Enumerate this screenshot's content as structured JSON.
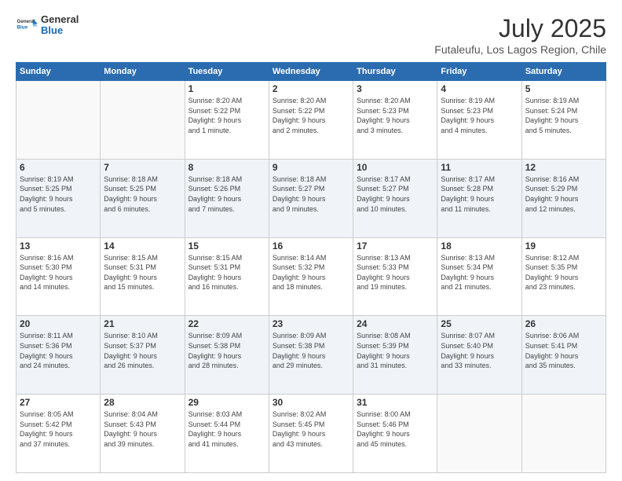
{
  "header": {
    "logo_general": "General",
    "logo_blue": "Blue",
    "main_title": "July 2025",
    "subtitle": "Futaleufu, Los Lagos Region, Chile"
  },
  "weekdays": [
    "Sunday",
    "Monday",
    "Tuesday",
    "Wednesday",
    "Thursday",
    "Friday",
    "Saturday"
  ],
  "weeks": [
    [
      {
        "day": "",
        "info": ""
      },
      {
        "day": "",
        "info": ""
      },
      {
        "day": "1",
        "info": "Sunrise: 8:20 AM\nSunset: 5:22 PM\nDaylight: 9 hours\nand 1 minute."
      },
      {
        "day": "2",
        "info": "Sunrise: 8:20 AM\nSunset: 5:22 PM\nDaylight: 9 hours\nand 2 minutes."
      },
      {
        "day": "3",
        "info": "Sunrise: 8:20 AM\nSunset: 5:23 PM\nDaylight: 9 hours\nand 3 minutes."
      },
      {
        "day": "4",
        "info": "Sunrise: 8:19 AM\nSunset: 5:23 PM\nDaylight: 9 hours\nand 4 minutes."
      },
      {
        "day": "5",
        "info": "Sunrise: 8:19 AM\nSunset: 5:24 PM\nDaylight: 9 hours\nand 5 minutes."
      }
    ],
    [
      {
        "day": "6",
        "info": "Sunrise: 8:19 AM\nSunset: 5:25 PM\nDaylight: 9 hours\nand 5 minutes."
      },
      {
        "day": "7",
        "info": "Sunrise: 8:18 AM\nSunset: 5:25 PM\nDaylight: 9 hours\nand 6 minutes."
      },
      {
        "day": "8",
        "info": "Sunrise: 8:18 AM\nSunset: 5:26 PM\nDaylight: 9 hours\nand 7 minutes."
      },
      {
        "day": "9",
        "info": "Sunrise: 8:18 AM\nSunset: 5:27 PM\nDaylight: 9 hours\nand 9 minutes."
      },
      {
        "day": "10",
        "info": "Sunrise: 8:17 AM\nSunset: 5:27 PM\nDaylight: 9 hours\nand 10 minutes."
      },
      {
        "day": "11",
        "info": "Sunrise: 8:17 AM\nSunset: 5:28 PM\nDaylight: 9 hours\nand 11 minutes."
      },
      {
        "day": "12",
        "info": "Sunrise: 8:16 AM\nSunset: 5:29 PM\nDaylight: 9 hours\nand 12 minutes."
      }
    ],
    [
      {
        "day": "13",
        "info": "Sunrise: 8:16 AM\nSunset: 5:30 PM\nDaylight: 9 hours\nand 14 minutes."
      },
      {
        "day": "14",
        "info": "Sunrise: 8:15 AM\nSunset: 5:31 PM\nDaylight: 9 hours\nand 15 minutes."
      },
      {
        "day": "15",
        "info": "Sunrise: 8:15 AM\nSunset: 5:31 PM\nDaylight: 9 hours\nand 16 minutes."
      },
      {
        "day": "16",
        "info": "Sunrise: 8:14 AM\nSunset: 5:32 PM\nDaylight: 9 hours\nand 18 minutes."
      },
      {
        "day": "17",
        "info": "Sunrise: 8:13 AM\nSunset: 5:33 PM\nDaylight: 9 hours\nand 19 minutes."
      },
      {
        "day": "18",
        "info": "Sunrise: 8:13 AM\nSunset: 5:34 PM\nDaylight: 9 hours\nand 21 minutes."
      },
      {
        "day": "19",
        "info": "Sunrise: 8:12 AM\nSunset: 5:35 PM\nDaylight: 9 hours\nand 23 minutes."
      }
    ],
    [
      {
        "day": "20",
        "info": "Sunrise: 8:11 AM\nSunset: 5:36 PM\nDaylight: 9 hours\nand 24 minutes."
      },
      {
        "day": "21",
        "info": "Sunrise: 8:10 AM\nSunset: 5:37 PM\nDaylight: 9 hours\nand 26 minutes."
      },
      {
        "day": "22",
        "info": "Sunrise: 8:09 AM\nSunset: 5:38 PM\nDaylight: 9 hours\nand 28 minutes."
      },
      {
        "day": "23",
        "info": "Sunrise: 8:09 AM\nSunset: 5:38 PM\nDaylight: 9 hours\nand 29 minutes."
      },
      {
        "day": "24",
        "info": "Sunrise: 8:08 AM\nSunset: 5:39 PM\nDaylight: 9 hours\nand 31 minutes."
      },
      {
        "day": "25",
        "info": "Sunrise: 8:07 AM\nSunset: 5:40 PM\nDaylight: 9 hours\nand 33 minutes."
      },
      {
        "day": "26",
        "info": "Sunrise: 8:06 AM\nSunset: 5:41 PM\nDaylight: 9 hours\nand 35 minutes."
      }
    ],
    [
      {
        "day": "27",
        "info": "Sunrise: 8:05 AM\nSunset: 5:42 PM\nDaylight: 9 hours\nand 37 minutes."
      },
      {
        "day": "28",
        "info": "Sunrise: 8:04 AM\nSunset: 5:43 PM\nDaylight: 9 hours\nand 39 minutes."
      },
      {
        "day": "29",
        "info": "Sunrise: 8:03 AM\nSunset: 5:44 PM\nDaylight: 9 hours\nand 41 minutes."
      },
      {
        "day": "30",
        "info": "Sunrise: 8:02 AM\nSunset: 5:45 PM\nDaylight: 9 hours\nand 43 minutes."
      },
      {
        "day": "31",
        "info": "Sunrise: 8:00 AM\nSunset: 5:46 PM\nDaylight: 9 hours\nand 45 minutes."
      },
      {
        "day": "",
        "info": ""
      },
      {
        "day": "",
        "info": ""
      }
    ]
  ]
}
